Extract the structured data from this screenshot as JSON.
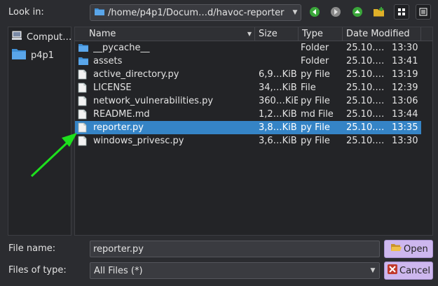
{
  "lookin": {
    "label": "Look in:",
    "path": "/home/p4p1/Docum…d/havoc-reporter"
  },
  "toolbar": {
    "back_icon": "arrow-left-icon",
    "forward_icon": "arrow-right-icon",
    "up_icon": "arrow-up-icon",
    "newfolder_icon": "new-folder-icon",
    "iconview_icon": "icon-view-icon",
    "detailview_icon": "detail-view-icon"
  },
  "sidebar": {
    "items": [
      {
        "label": "Comput…",
        "icon": "computer-icon"
      },
      {
        "label": "p4p1",
        "icon": "folder-icon"
      }
    ]
  },
  "columns": {
    "name": "Name",
    "size": "Size",
    "type": "Type",
    "date": "Date Modified"
  },
  "files": [
    {
      "name": "__pycache__",
      "size": "",
      "type": "Folder",
      "date": "25.10.…",
      "time": "13:30",
      "icon": "folder-icon"
    },
    {
      "name": "assets",
      "size": "",
      "type": "Folder",
      "date": "25.10.…",
      "time": "13:41",
      "icon": "folder-icon"
    },
    {
      "name": "active_directory.py",
      "size": "6,9…KiB",
      "type": "py File",
      "date": "25.10.…",
      "time": "13:19",
      "icon": "file-icon"
    },
    {
      "name": "LICENSE",
      "size": "34,…KiB",
      "type": "File",
      "date": "25.10.…",
      "time": "12:39",
      "icon": "file-icon"
    },
    {
      "name": "network_vulnerabilities.py",
      "size": "360…KiB",
      "type": "py File",
      "date": "25.10.…",
      "time": "13:06",
      "icon": "file-icon"
    },
    {
      "name": "README.md",
      "size": "1,2…KiB",
      "type": "md File",
      "date": "25.10.…",
      "time": "13:44",
      "icon": "file-icon"
    },
    {
      "name": "reporter.py",
      "size": "3,8…KiB",
      "type": "py File",
      "date": "25.10.…",
      "time": "13:35",
      "icon": "file-icon",
      "selected": true
    },
    {
      "name": "windows_privesc.py",
      "size": "3,6…KiB",
      "type": "py File",
      "date": "25.10.…",
      "time": "13:30",
      "icon": "file-icon"
    }
  ],
  "filename": {
    "label": "File name:",
    "value": "reporter.py"
  },
  "filetype": {
    "label": "Files of type:",
    "value": "All Files (*)"
  },
  "buttons": {
    "open": "Open",
    "cancel": "Cancel"
  },
  "annotation": {
    "arrow_icon": "green-arrow-icon",
    "color": "#1de01d"
  },
  "colors": {
    "selection": "#3584c6",
    "button": "#cdb7ee",
    "folder": "#3f8fd6"
  }
}
